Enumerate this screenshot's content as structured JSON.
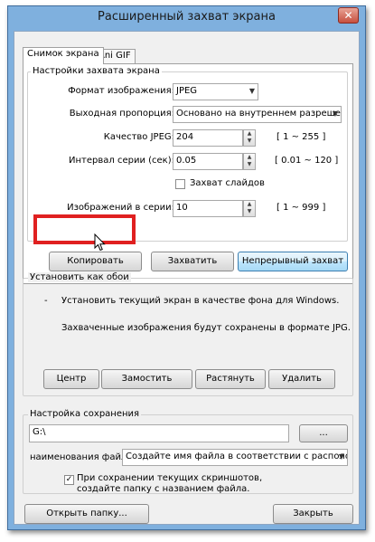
{
  "window": {
    "title": "Расширенный захват экрана",
    "close_glyph": "✕"
  },
  "tabs": [
    {
      "label": "Снимок экрана"
    },
    {
      "label": "Ani GIF"
    }
  ],
  "capture_settings": {
    "group_title": "Настройки захвата экрана",
    "image_format": {
      "label": "Формат изображения:",
      "value": "JPEG"
    },
    "aspect": {
      "label": "Выходная пропорция:",
      "value": "Основано на внутреннем разрешении"
    },
    "quality": {
      "label": "Качество JPEG:",
      "value": "204",
      "range": "[ 1 ~ 255 ]"
    },
    "interval": {
      "label": "Интервал серии (сек):",
      "value": "0.05",
      "range": "[ 0.01 ~ 120 ]"
    },
    "slides": {
      "label": "Захват слайдов",
      "checked": false
    },
    "count": {
      "label": "Изображений в серии:",
      "value": "10",
      "range": "[ 1 ~ 999 ]"
    }
  },
  "actions": {
    "copy": "Копировать",
    "capture": "Захватить",
    "continuous": "Непрерывный захват"
  },
  "wallpaper": {
    "group_title": "Установить как обои",
    "bullet": "-",
    "line1": "Установить текущий экран в качестве фона для Windows.",
    "line2": "Захваченные изображения будут сохранены в формате JPG.",
    "buttons": {
      "center": "Центр",
      "tile": "Замостить",
      "stretch": "Растянуть",
      "delete": "Удалить"
    }
  },
  "save": {
    "group_title": "Настройка сохранения",
    "path": "G:\\",
    "browse": "...",
    "filename_label": "наименования файл:",
    "filename_value": "Создайте имя файла в соответствии с расположением",
    "folder_option": {
      "label": "При сохранении текущих скриншотов, создайте папку с названием файла.",
      "checked": true
    }
  },
  "footer": {
    "open_folder": "Открыть папку...",
    "close": "Закрыть"
  },
  "icons": {
    "dropdown": "chevron-down-icon",
    "spin": "spin-arrows-icon",
    "checkmark": "check-icon"
  }
}
